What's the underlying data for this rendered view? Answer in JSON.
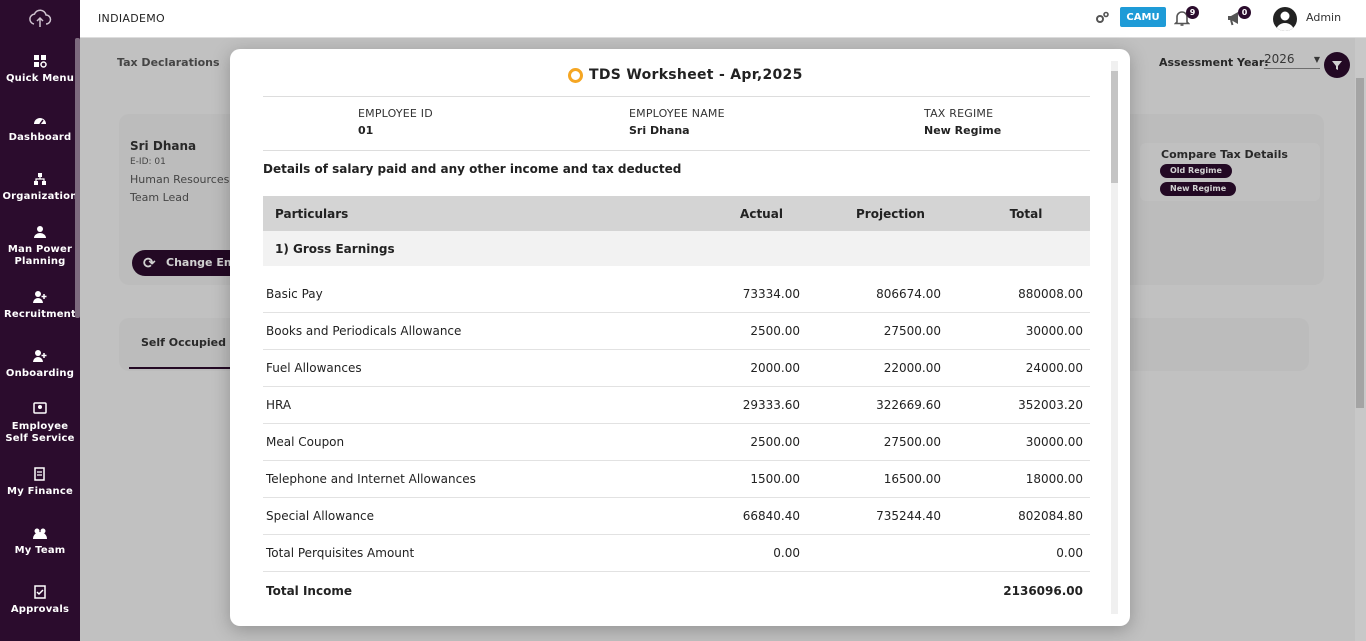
{
  "app": {
    "company": "INDIADEMO",
    "brand_badge": "CAMU",
    "user": "Admin"
  },
  "notifications": {
    "bell_count": "9",
    "announcement_count": "0"
  },
  "sidebar": {
    "items": [
      {
        "label": "Quick Menu",
        "icon": "quick-menu-icon"
      },
      {
        "label": "Dashboard",
        "icon": "dashboard-icon"
      },
      {
        "label": "Organization",
        "icon": "organization-icon"
      },
      {
        "label": "Man Power Planning",
        "icon": "manpower-icon"
      },
      {
        "label": "Recruitment",
        "icon": "recruitment-icon"
      },
      {
        "label": "Onboarding",
        "icon": "onboarding-icon"
      },
      {
        "label": "Employee Self Service",
        "icon": "self-service-icon"
      },
      {
        "label": "My Finance",
        "icon": "finance-icon"
      },
      {
        "label": "My Team",
        "icon": "team-icon"
      },
      {
        "label": "Approvals",
        "icon": "approvals-icon"
      }
    ]
  },
  "background": {
    "tab": "Tax Declarations",
    "assessment_year_label": "Assessment Year:",
    "assessment_year": "2026",
    "employee": {
      "name": "Sri Dhana",
      "eid": "E-ID: 01",
      "department": "Human Resources",
      "role": "Team Lead"
    },
    "change_button": "Change Emp",
    "compare": {
      "title": "Compare Tax Details",
      "old": "Old Regime",
      "new": "New Regime"
    },
    "tab_self_occupied": "Self Occupied"
  },
  "modal": {
    "title": "TDS Worksheet - Apr,2025",
    "employee_id_label": "EMPLOYEE ID",
    "employee_id": "01",
    "employee_name_label": "EMPLOYEE NAME",
    "employee_name": "Sri Dhana",
    "tax_regime_label": "TAX REGIME",
    "tax_regime": "New Regime",
    "details_heading": "Details of salary paid and any other income and tax deducted",
    "table": {
      "headers": {
        "particulars": "Particulars",
        "actual": "Actual",
        "projection": "Projection",
        "total": "Total"
      },
      "section": "1) Gross Earnings",
      "rows": [
        {
          "name": "Basic Pay",
          "actual": "73334.00",
          "projection": "806674.00",
          "total": "880008.00"
        },
        {
          "name": "Books and Periodicals Allowance",
          "actual": "2500.00",
          "projection": "27500.00",
          "total": "30000.00"
        },
        {
          "name": "Fuel Allowances",
          "actual": "2000.00",
          "projection": "22000.00",
          "total": "24000.00"
        },
        {
          "name": "HRA",
          "actual": "29333.60",
          "projection": "322669.60",
          "total": "352003.20"
        },
        {
          "name": "Meal Coupon",
          "actual": "2500.00",
          "projection": "27500.00",
          "total": "30000.00"
        },
        {
          "name": "Telephone and Internet Allowances",
          "actual": "1500.00",
          "projection": "16500.00",
          "total": "18000.00"
        },
        {
          "name": "Special Allowance",
          "actual": "66840.40",
          "projection": "735244.40",
          "total": "802084.80"
        },
        {
          "name": "Total Perquisites Amount",
          "actual": "0.00",
          "projection": "",
          "total": "0.00"
        }
      ],
      "total_row": {
        "name": "Total Income",
        "total": "2136096.00"
      }
    }
  },
  "colors": {
    "sidebar_bg": "#2b0c2d",
    "accent": "#1e9bd7",
    "title_ring": "#f5a623"
  }
}
